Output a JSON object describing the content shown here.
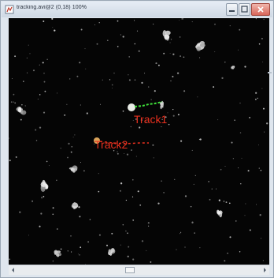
{
  "window": {
    "title": "tracking.avi@2 (0,18) 100%",
    "buttons": [
      "minimize",
      "maximize",
      "close"
    ]
  },
  "viewer": {
    "tracks": [
      {
        "label": "Track1",
        "color": "#e8301e",
        "path_color": "#3fe03a"
      },
      {
        "label": "Track2",
        "color": "#e8301e",
        "path_color": "#e8301e"
      }
    ]
  },
  "scrollbar": {
    "orientation": "horizontal"
  },
  "colors": {
    "background": "#050505",
    "label": "#e8301e",
    "track1_path": "#3fe03a"
  }
}
